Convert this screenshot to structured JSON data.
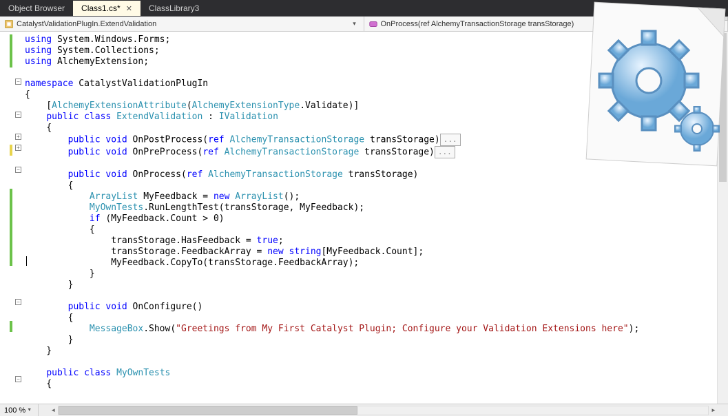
{
  "tabs": {
    "object_browser": "Object Browser",
    "class1": "Class1.cs*",
    "class_library": "ClassLibrary3"
  },
  "nav": {
    "left": "CatalystValidationPlugIn.ExtendValidation",
    "right": "OnProcess(ref AlchemyTransactionStorage transStorage)"
  },
  "status": {
    "zoom": "100 %"
  },
  "code": {
    "l1_a": "using",
    "l1_b": " System.Windows.Forms;",
    "l2_a": "using",
    "l2_b": " System.Collections;",
    "l3_a": "using",
    "l3_b": " AlchemyExtension;",
    "l5_a": "namespace",
    "l5_b": " CatalystValidationPlugIn",
    "l6": "{",
    "l7_a": "    [",
    "l7_b": "AlchemyExtensionAttribute",
    "l7_c": "(",
    "l7_d": "AlchemyExtensionType",
    "l7_e": ".Validate)]",
    "l8_a": "    ",
    "l8_b": "public",
    "l8_c": " ",
    "l8_d": "class",
    "l8_e": " ",
    "l8_f": "ExtendValidation",
    "l8_g": " : ",
    "l8_h": "IValidation",
    "l9": "    {",
    "l10_a": "        ",
    "l10_b": "public",
    "l10_c": " ",
    "l10_d": "void",
    "l10_e": " OnPostProcess(",
    "l10_f": "ref",
    "l10_g": " ",
    "l10_h": "AlchemyTransactionStorage",
    "l10_i": " transStorage)",
    "l11_a": "        ",
    "l11_b": "public",
    "l11_c": " ",
    "l11_d": "void",
    "l11_e": " OnPreProcess(",
    "l11_f": "ref",
    "l11_g": " ",
    "l11_h": "AlchemyTransactionStorage",
    "l11_i": " transStorage)",
    "l13_a": "        ",
    "l13_b": "public",
    "l13_c": " ",
    "l13_d": "void",
    "l13_e": " OnProcess(",
    "l13_f": "ref",
    "l13_g": " ",
    "l13_h": "AlchemyTransactionStorage",
    "l13_i": " transStorage)",
    "l14": "        {",
    "l15_a": "            ",
    "l15_b": "ArrayList",
    "l15_c": " MyFeedback = ",
    "l15_d": "new",
    "l15_e": " ",
    "l15_f": "ArrayList",
    "l15_g": "();",
    "l16_a": "            ",
    "l16_b": "MyOwnTests",
    "l16_c": ".RunLengthTest(transStorage, MyFeedback);",
    "l17_a": "            ",
    "l17_b": "if",
    "l17_c": " (MyFeedback.Count > 0)",
    "l18": "            {",
    "l19_a": "                transStorage.HasFeedback = ",
    "l19_b": "true",
    "l19_c": ";",
    "l20_a": "                transStorage.FeedbackArray = ",
    "l20_b": "new",
    "l20_c": " ",
    "l20_d": "string",
    "l20_e": "[MyFeedback.Count];",
    "l21": "                MyFeedback.CopyTo(transStorage.FeedbackArray);",
    "l22": "            }",
    "l23": "        }",
    "l25_a": "        ",
    "l25_b": "public",
    "l25_c": " ",
    "l25_d": "void",
    "l25_e": " OnConfigure()",
    "l26": "        {",
    "l27_a": "            ",
    "l27_b": "MessageBox",
    "l27_c": ".Show(",
    "l27_d": "\"Greetings from My First Catalyst Plugin; Configure your Validation Extensions here\"",
    "l27_e": ");",
    "l28": "        }",
    "l29": "    }",
    "l31_a": "    ",
    "l31_b": "public",
    "l31_c": " ",
    "l31_d": "class",
    "l31_e": " ",
    "l31_f": "MyOwnTests",
    "l32": "    {",
    "ellipsis": "..."
  }
}
